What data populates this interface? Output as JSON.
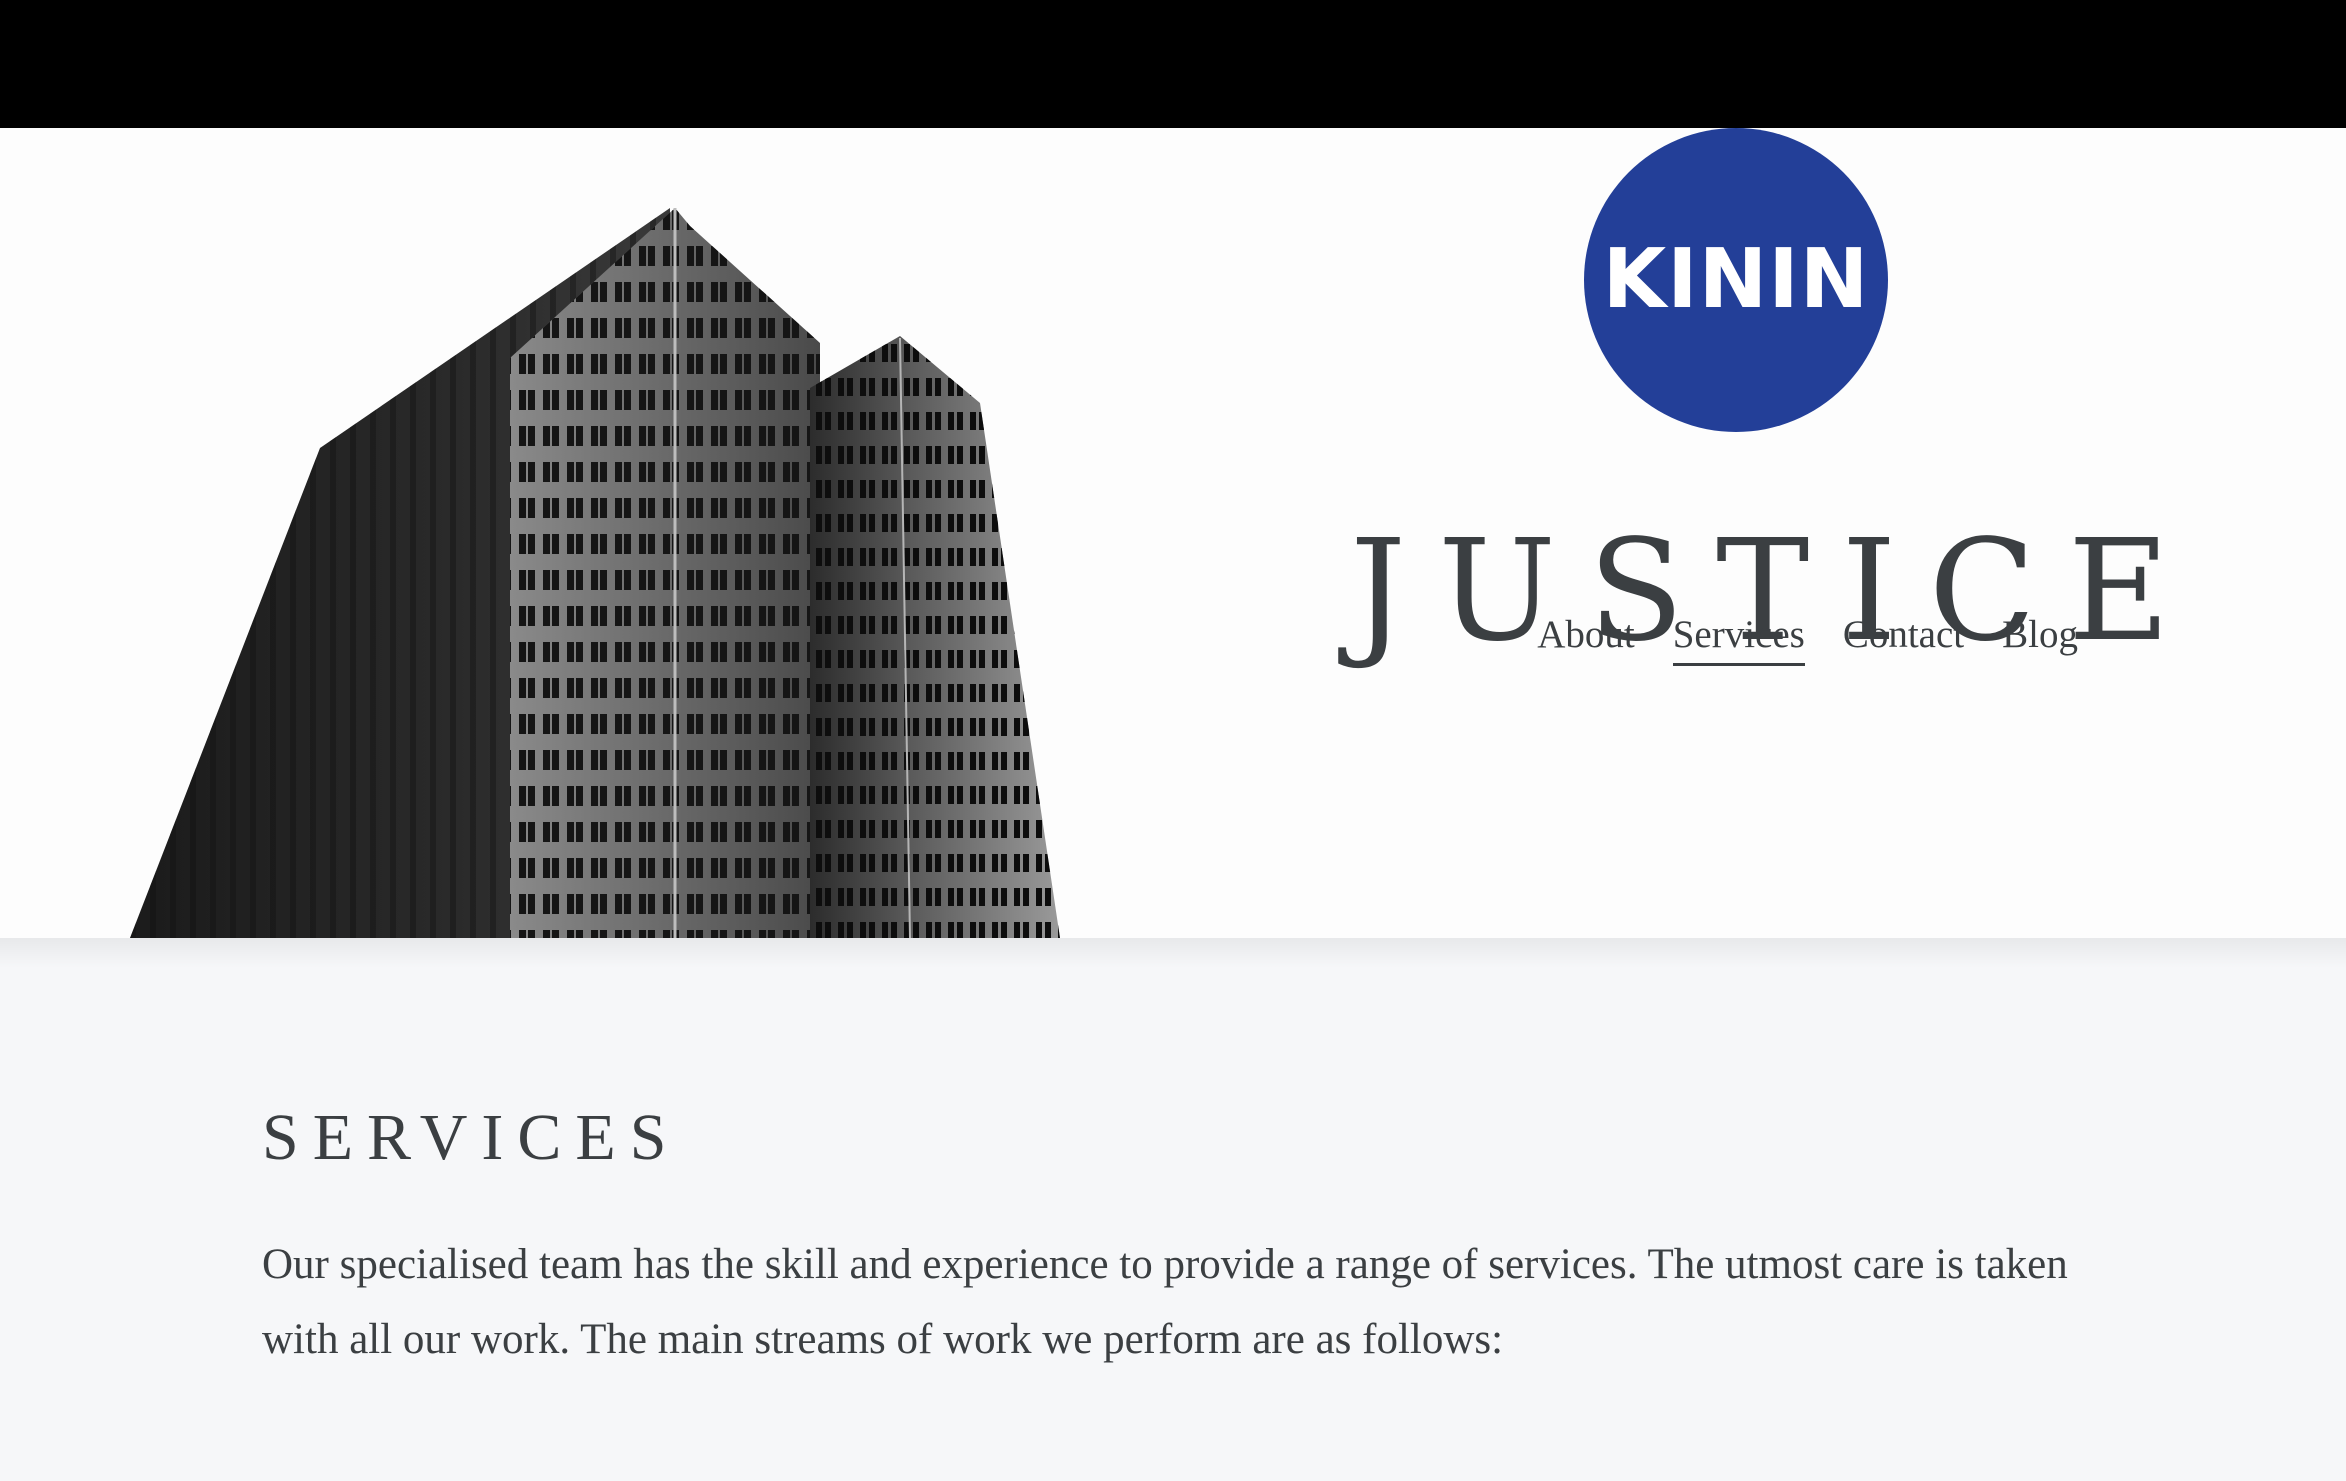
{
  "logo": {
    "text": "KININ",
    "color": "#233f98"
  },
  "site": {
    "title": "JUSTICE"
  },
  "nav": {
    "items": [
      {
        "label": "About",
        "active": false
      },
      {
        "label": "Services",
        "active": true
      },
      {
        "label": "Contact",
        "active": false
      },
      {
        "label": "Blog",
        "active": false
      }
    ]
  },
  "hero": {
    "image": "building-photo"
  },
  "services": {
    "heading": "SERVICES",
    "intro": "Our specialised team has the skill and experience to provide a range of services. The utmost care is taken with all our work. The main streams of work we perform are as follows:"
  },
  "colors": {
    "top_bar": "#000000",
    "text": "#3b3f42",
    "content_bg": "#f6f7f9",
    "hero_bg": "#fdfdfd"
  }
}
